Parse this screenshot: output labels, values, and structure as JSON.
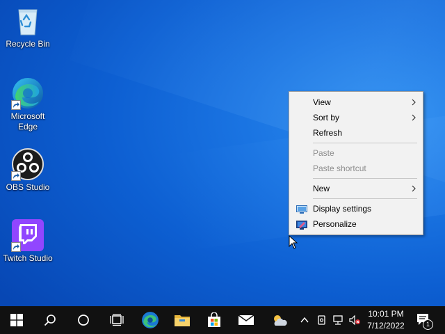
{
  "desktop": {
    "icons": [
      {
        "label": "Recycle Bin",
        "icon": "recycle-bin-icon"
      },
      {
        "label": "Microsoft Edge",
        "icon": "edge-icon"
      },
      {
        "label": "OBS Studio",
        "icon": "obs-icon"
      },
      {
        "label": "Twitch Studio",
        "icon": "twitch-icon"
      }
    ]
  },
  "context_menu": {
    "items": [
      {
        "label": "View",
        "enabled": true,
        "submenu": true
      },
      {
        "label": "Sort by",
        "enabled": true,
        "submenu": true
      },
      {
        "label": "Refresh",
        "enabled": true
      },
      {
        "label": "Paste",
        "enabled": false
      },
      {
        "label": "Paste shortcut",
        "enabled": false
      },
      {
        "label": "New",
        "enabled": true,
        "submenu": true
      },
      {
        "label": "Display settings",
        "enabled": true,
        "icon": "display-icon"
      },
      {
        "label": "Personalize",
        "enabled": true,
        "icon": "personalize-icon"
      }
    ]
  },
  "taskbar": {
    "apps": [
      "start-icon",
      "search-icon",
      "cortana-icon",
      "task-view-icon",
      "edge-icon",
      "file-explorer-icon",
      "store-icon",
      "mail-icon",
      "weather-icon"
    ],
    "tray_icons": [
      "chevron-up-icon",
      "meet-now-icon",
      "network-icon",
      "volume-muted-icon"
    ],
    "clock": {
      "time": "10:01 PM",
      "date": "7/12/2022"
    },
    "notifications": {
      "count": "1"
    }
  },
  "colors": {
    "taskbar": "#111111",
    "menu_bg": "#f2f2f2",
    "disabled_text": "#8d8d8d",
    "accent": "#0078d7"
  }
}
